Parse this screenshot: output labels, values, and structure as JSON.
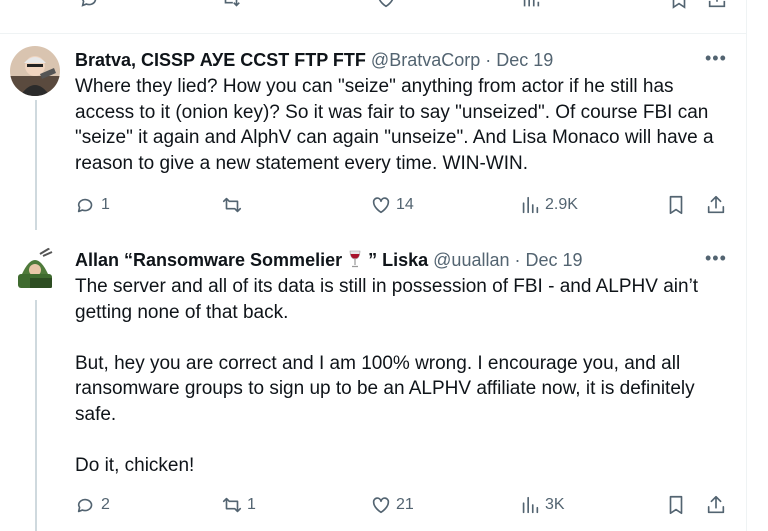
{
  "tweets": [
    {
      "name": "Bratva, CISSP АУЕ CCST FTP FTF",
      "handle": "@BratvaCorp",
      "sep": "·",
      "date": "Dec 19",
      "more": "•••",
      "text": [
        "Where they lied? How you can \"seize\" anything from actor if he still has access to it (onion key)? So it was fair to say \"unseized\". Of course FBI can \"seize\" it again and AlphV can again \"unseize\". And Lisa Monaco will have a reason to give a new statement every time. WIN-WIN."
      ],
      "replies": "1",
      "retweets": "",
      "likes": "14",
      "views": "2.9K"
    },
    {
      "name_part1": "Allan “Ransomware Sommelier",
      "name_part2": " ” Liska",
      "handle": "@uuallan",
      "sep": "·",
      "date": "Dec 19",
      "more": "•••",
      "text": [
        "The server and all of its data is still in possession of FBI - and ALPHV ain’t getting none of that back.",
        "But, hey you are correct and I am 100% wrong. I encourage you, and all ransomware groups to sign up to be an ALPHV affiliate now, it is definitely safe.",
        "Do it, chicken!"
      ],
      "replies": "2",
      "retweets": "1",
      "likes": "21",
      "views": "3K"
    }
  ],
  "colors": {
    "text": "#0f1419",
    "secondary": "#536471",
    "divider": "#eff3f4",
    "thread": "#cfd9de"
  },
  "icons": [
    "reply-icon",
    "retweet-icon",
    "like-icon",
    "views-icon",
    "bookmark-icon",
    "share-icon",
    "wine-glass-icon"
  ]
}
